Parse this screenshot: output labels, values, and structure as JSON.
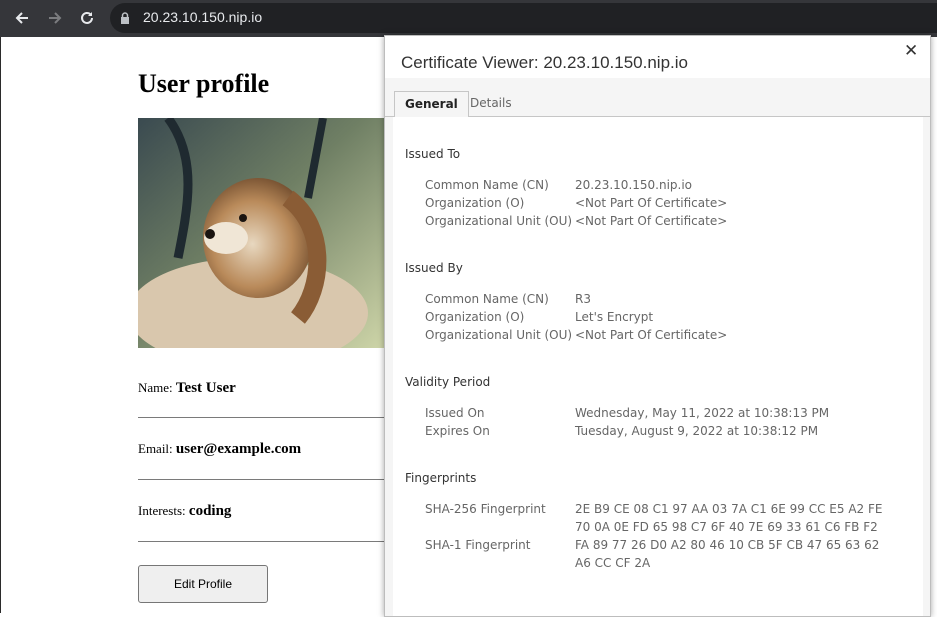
{
  "browser": {
    "url": "20.23.10.150.nip.io",
    "icons": {
      "back": "arrow-left-icon",
      "forward": "arrow-right-icon",
      "reload": "reload-icon",
      "lock": "lock-icon"
    }
  },
  "page": {
    "title": "User profile",
    "fields": [
      {
        "label": "Name:",
        "value": "Test User"
      },
      {
        "label": "Email:",
        "value": "user@example.com"
      },
      {
        "label": "Interests:",
        "value": "coding"
      }
    ],
    "edit_button": "Edit Profile"
  },
  "certificate": {
    "title": "Certificate Viewer: 20.23.10.150.nip.io",
    "close_icon": "close-icon",
    "tabs": [
      "General",
      "Details"
    ],
    "issued_to": {
      "heading": "Issued To",
      "rows": [
        {
          "label": "Common Name (CN)",
          "value": "20.23.10.150.nip.io"
        },
        {
          "label": "Organization (O)",
          "value": "<Not Part Of Certificate>"
        },
        {
          "label": "Organizational Unit (OU)",
          "value": "<Not Part Of Certificate>"
        }
      ]
    },
    "issued_by": {
      "heading": "Issued By",
      "rows": [
        {
          "label": "Common Name (CN)",
          "value": "R3"
        },
        {
          "label": "Organization (O)",
          "value": "Let's Encrypt"
        },
        {
          "label": "Organizational Unit (OU)",
          "value": "<Not Part Of Certificate>"
        }
      ]
    },
    "validity": {
      "heading": "Validity Period",
      "rows": [
        {
          "label": "Issued On",
          "value": "Wednesday, May 11, 2022 at 10:38:13 PM"
        },
        {
          "label": "Expires On",
          "value": "Tuesday, August 9, 2022 at 10:38:12 PM"
        }
      ]
    },
    "fingerprints": {
      "heading": "Fingerprints",
      "sha256_label": "SHA-256 Fingerprint",
      "sha256_line1": "2E B9 CE 08 C1 97 AA 03 7A C1 6E 99 CC E5 A2 FE",
      "sha256_line2": "70 0A 0E FD 65 98 C7 6F 40 7E 69 33 61 C6 FB F2",
      "sha1_label": "SHA-1 Fingerprint",
      "sha1_line1": "FA 89 77 26 D0 A2 80 46 10 CB 5F CB 47 65 63 62",
      "sha1_line2": "A6 CC CF 2A"
    }
  }
}
